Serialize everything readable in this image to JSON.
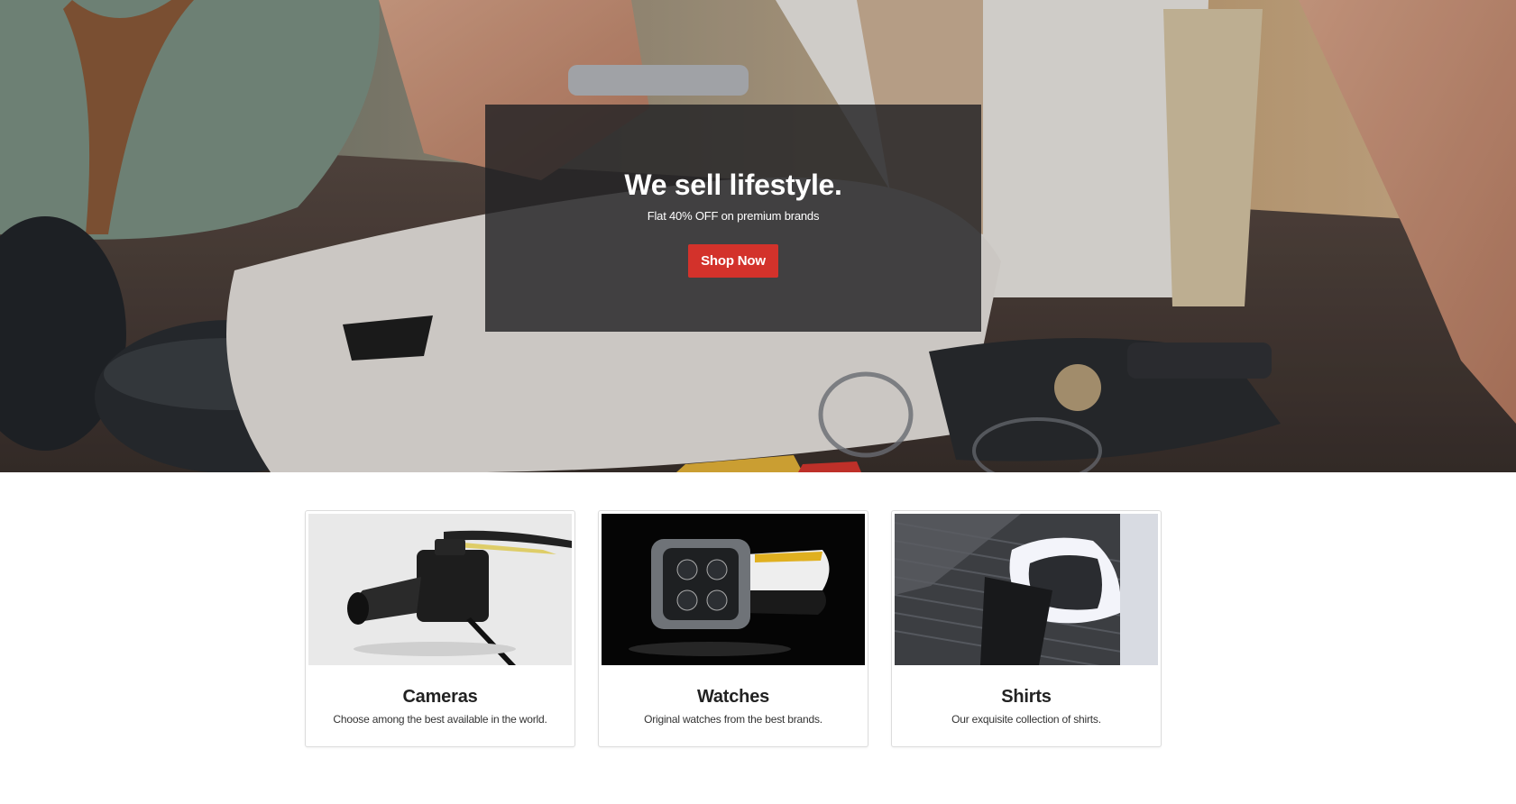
{
  "hero": {
    "title": "We sell lifestyle.",
    "subtitle": "Flat 40% OFF on premium brands",
    "button_label": "Shop Now",
    "accent_color": "#d3322b"
  },
  "categories": [
    {
      "title": "Cameras",
      "description": "Choose among the best available in the world.",
      "image": "camera-photo"
    },
    {
      "title": "Watches",
      "description": "Original watches from the best brands.",
      "image": "watch-photo"
    },
    {
      "title": "Shirts",
      "description": "Our exquisite collection of shirts.",
      "image": "shirt-photo"
    }
  ]
}
